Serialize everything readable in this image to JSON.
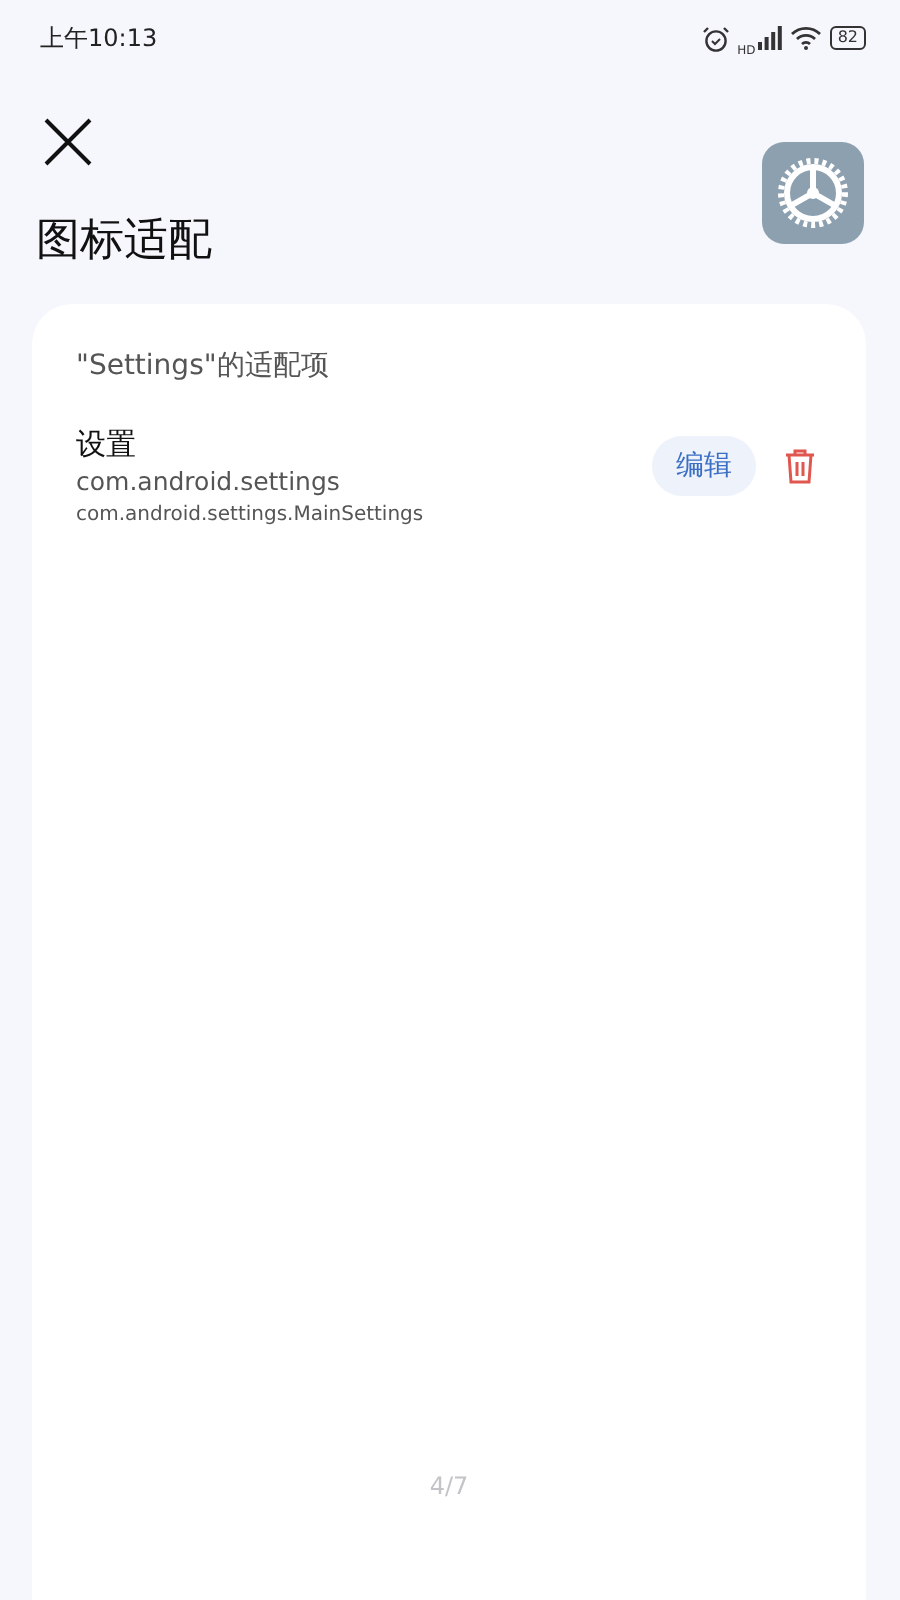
{
  "status_bar": {
    "time": "上午10:13",
    "signal_label": "HD",
    "battery": "82"
  },
  "header": {
    "title": "图标适配"
  },
  "card": {
    "heading": "\"Settings\"的适配项",
    "items": [
      {
        "name": "设置",
        "package": "com.android.settings",
        "activity": "com.android.settings.MainSettings",
        "edit_label": "编辑"
      }
    ]
  },
  "pager": "4/7"
}
